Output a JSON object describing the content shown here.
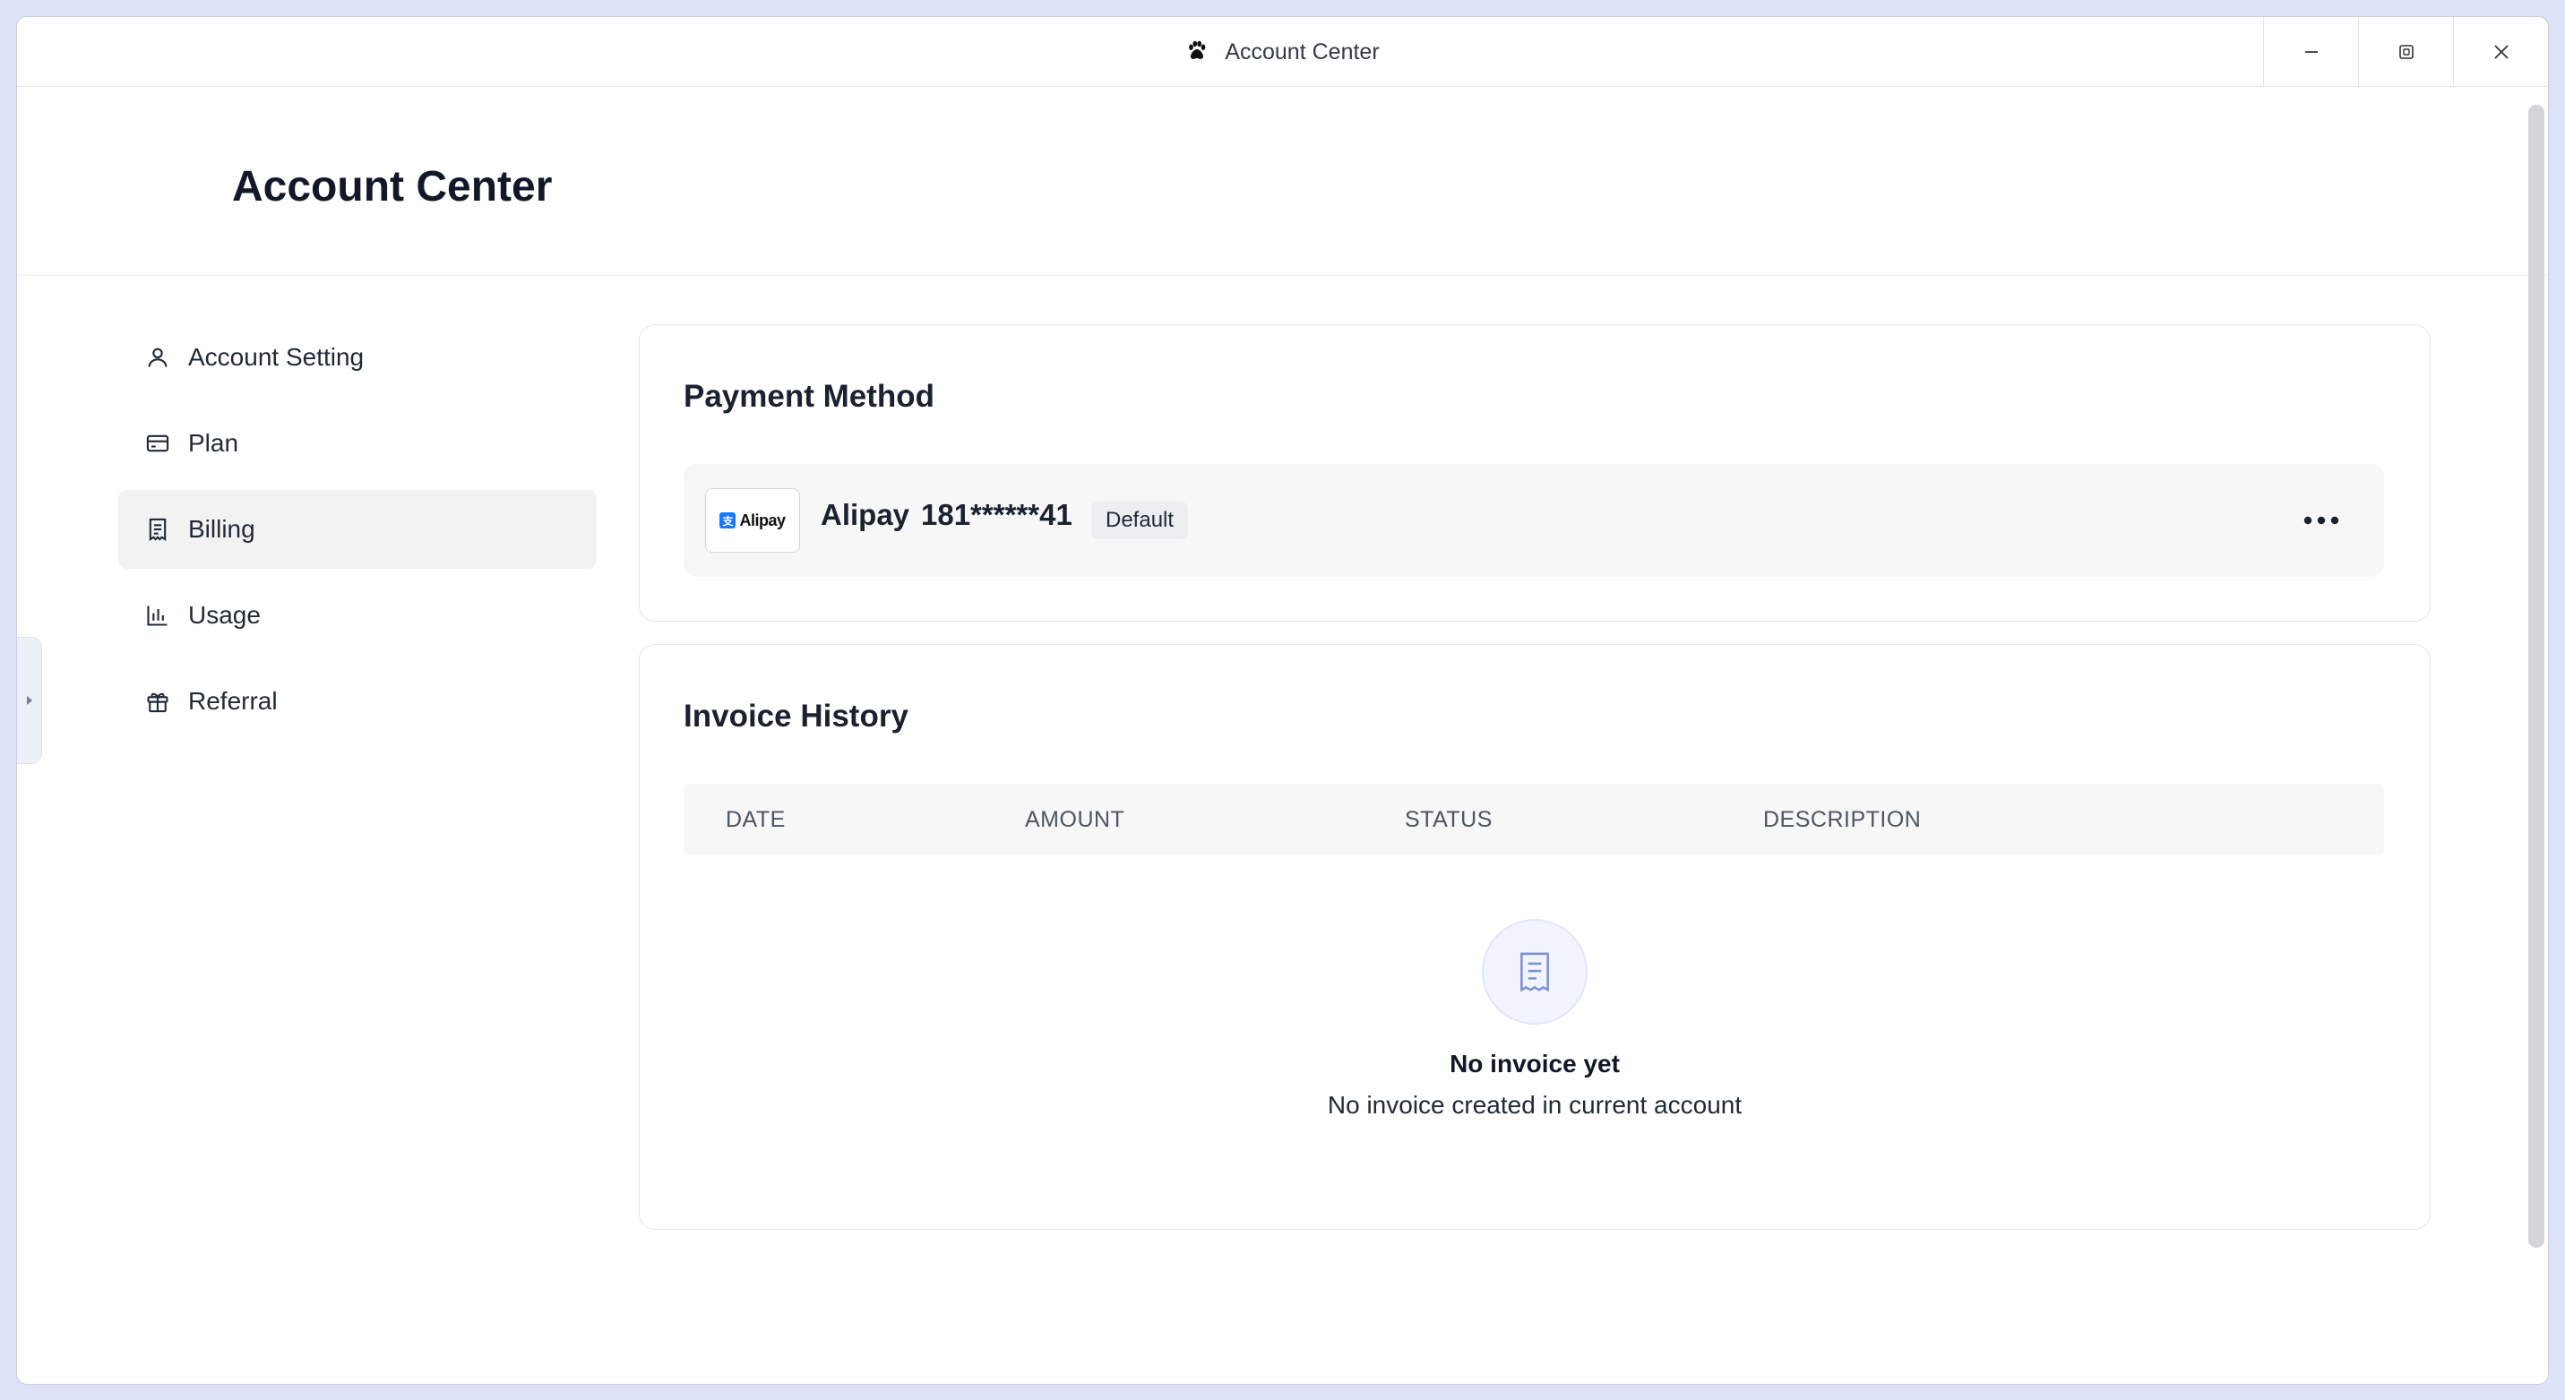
{
  "window": {
    "title": "Account Center",
    "app_icon": "paw-icon",
    "controls": [
      "minimize-icon",
      "restore-icon",
      "close-icon"
    ]
  },
  "header": {
    "title": "Account Center"
  },
  "sidebar": {
    "items": [
      {
        "label": "Account Setting",
        "icon": "user-icon",
        "active": false
      },
      {
        "label": "Plan",
        "icon": "credit-card-icon",
        "active": false
      },
      {
        "label": "Billing",
        "icon": "receipt-icon",
        "active": true
      },
      {
        "label": "Usage",
        "icon": "bar-chart-icon",
        "active": false
      },
      {
        "label": "Referral",
        "icon": "gift-icon",
        "active": false
      }
    ]
  },
  "payment": {
    "title": "Payment Method",
    "method": {
      "logo_text": "Alipay",
      "name": "Alipay",
      "number": "181******41",
      "badge": "Default"
    }
  },
  "invoices": {
    "title": "Invoice History",
    "columns": [
      "DATE",
      "AMOUNT",
      "STATUS",
      "DESCRIPTION"
    ],
    "rows": [],
    "empty": {
      "title": "No invoice yet",
      "subtitle": "No invoice created in current account"
    }
  },
  "colors": {
    "background": "#dde3f7",
    "active_nav": "#f2f2f2",
    "alipay_blue": "#1677ff",
    "empty_icon": "#7d93d8"
  }
}
